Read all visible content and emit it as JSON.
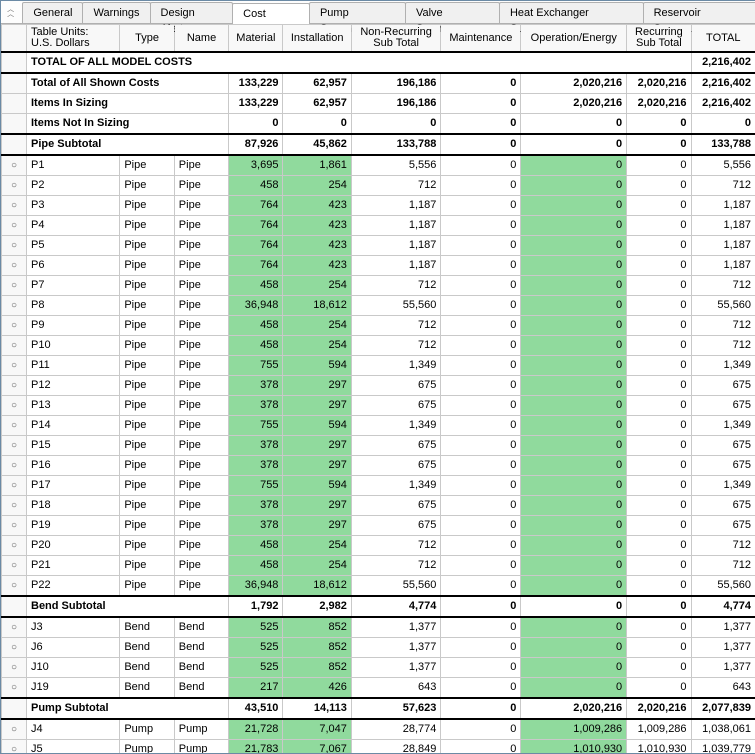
{
  "tabs": [
    {
      "label": "General",
      "active": false
    },
    {
      "label": "Warnings",
      "active": false
    },
    {
      "label": "Design Alerts",
      "active": false
    },
    {
      "label": "Cost Report",
      "active": true
    },
    {
      "label": "Pump Summary",
      "active": false
    },
    {
      "label": "Valve Summary",
      "active": false
    },
    {
      "label": "Heat Exchanger Summary",
      "active": false
    },
    {
      "label": "Reservoir Summary",
      "active": false
    }
  ],
  "headers": {
    "units_l1": "Table Units:",
    "units_l2": "U.S. Dollars",
    "type": "Type",
    "name": "Name",
    "material": "Material",
    "installation": "Installation",
    "nonrec_l1": "Non-Recurring",
    "nonrec_l2": "Sub Total",
    "maintenance": "Maintenance",
    "operation": "Operation/Energy",
    "rec_l1": "Recurring",
    "rec_l2": "Sub Total",
    "total": "TOTAL"
  },
  "rows": [
    {
      "kind": "grand",
      "label": "TOTAL OF ALL MODEL COSTS",
      "total": "2,216,402"
    },
    {
      "kind": "bold",
      "label": "Total of All Shown Costs",
      "mat": "133,229",
      "inst": "62,957",
      "nr": "196,186",
      "mnt": "0",
      "op": "2,020,216",
      "rec": "2,020,216",
      "tot": "2,216,402"
    },
    {
      "kind": "bold",
      "label": "Items In Sizing",
      "mat": "133,229",
      "inst": "62,957",
      "nr": "196,186",
      "mnt": "0",
      "op": "2,020,216",
      "rec": "2,020,216",
      "tot": "2,216,402"
    },
    {
      "kind": "bold",
      "label": "Items Not In Sizing",
      "mat": "0",
      "inst": "0",
      "nr": "0",
      "mnt": "0",
      "op": "0",
      "rec": "0",
      "tot": "0"
    },
    {
      "kind": "sub",
      "label": "Pipe Subtotal",
      "mat": "87,926",
      "inst": "45,862",
      "nr": "133,788",
      "mnt": "0",
      "op": "0",
      "rec": "0",
      "tot": "133,788"
    },
    {
      "kind": "item",
      "label": "P1",
      "type": "Pipe",
      "name": "Pipe",
      "mat": "3,695",
      "inst": "1,861",
      "nr": "5,556",
      "mnt": "0",
      "op": "0",
      "rec": "0",
      "tot": "5,556"
    },
    {
      "kind": "item",
      "label": "P2",
      "type": "Pipe",
      "name": "Pipe",
      "mat": "458",
      "inst": "254",
      "nr": "712",
      "mnt": "0",
      "op": "0",
      "rec": "0",
      "tot": "712"
    },
    {
      "kind": "item",
      "label": "P3",
      "type": "Pipe",
      "name": "Pipe",
      "mat": "764",
      "inst": "423",
      "nr": "1,187",
      "mnt": "0",
      "op": "0",
      "rec": "0",
      "tot": "1,187"
    },
    {
      "kind": "item",
      "label": "P4",
      "type": "Pipe",
      "name": "Pipe",
      "mat": "764",
      "inst": "423",
      "nr": "1,187",
      "mnt": "0",
      "op": "0",
      "rec": "0",
      "tot": "1,187"
    },
    {
      "kind": "item",
      "label": "P5",
      "type": "Pipe",
      "name": "Pipe",
      "mat": "764",
      "inst": "423",
      "nr": "1,187",
      "mnt": "0",
      "op": "0",
      "rec": "0",
      "tot": "1,187"
    },
    {
      "kind": "item",
      "label": "P6",
      "type": "Pipe",
      "name": "Pipe",
      "mat": "764",
      "inst": "423",
      "nr": "1,187",
      "mnt": "0",
      "op": "0",
      "rec": "0",
      "tot": "1,187"
    },
    {
      "kind": "item",
      "label": "P7",
      "type": "Pipe",
      "name": "Pipe",
      "mat": "458",
      "inst": "254",
      "nr": "712",
      "mnt": "0",
      "op": "0",
      "rec": "0",
      "tot": "712"
    },
    {
      "kind": "item",
      "label": "P8",
      "type": "Pipe",
      "name": "Pipe",
      "mat": "36,948",
      "inst": "18,612",
      "nr": "55,560",
      "mnt": "0",
      "op": "0",
      "rec": "0",
      "tot": "55,560"
    },
    {
      "kind": "item",
      "label": "P9",
      "type": "Pipe",
      "name": "Pipe",
      "mat": "458",
      "inst": "254",
      "nr": "712",
      "mnt": "0",
      "op": "0",
      "rec": "0",
      "tot": "712"
    },
    {
      "kind": "item",
      "label": "P10",
      "type": "Pipe",
      "name": "Pipe",
      "mat": "458",
      "inst": "254",
      "nr": "712",
      "mnt": "0",
      "op": "0",
      "rec": "0",
      "tot": "712"
    },
    {
      "kind": "item",
      "label": "P11",
      "type": "Pipe",
      "name": "Pipe",
      "mat": "755",
      "inst": "594",
      "nr": "1,349",
      "mnt": "0",
      "op": "0",
      "rec": "0",
      "tot": "1,349"
    },
    {
      "kind": "item",
      "label": "P12",
      "type": "Pipe",
      "name": "Pipe",
      "mat": "378",
      "inst": "297",
      "nr": "675",
      "mnt": "0",
      "op": "0",
      "rec": "0",
      "tot": "675"
    },
    {
      "kind": "item",
      "label": "P13",
      "type": "Pipe",
      "name": "Pipe",
      "mat": "378",
      "inst": "297",
      "nr": "675",
      "mnt": "0",
      "op": "0",
      "rec": "0",
      "tot": "675"
    },
    {
      "kind": "item",
      "label": "P14",
      "type": "Pipe",
      "name": "Pipe",
      "mat": "755",
      "inst": "594",
      "nr": "1,349",
      "mnt": "0",
      "op": "0",
      "rec": "0",
      "tot": "1,349"
    },
    {
      "kind": "item",
      "label": "P15",
      "type": "Pipe",
      "name": "Pipe",
      "mat": "378",
      "inst": "297",
      "nr": "675",
      "mnt": "0",
      "op": "0",
      "rec": "0",
      "tot": "675"
    },
    {
      "kind": "item",
      "label": "P16",
      "type": "Pipe",
      "name": "Pipe",
      "mat": "378",
      "inst": "297",
      "nr": "675",
      "mnt": "0",
      "op": "0",
      "rec": "0",
      "tot": "675"
    },
    {
      "kind": "item",
      "label": "P17",
      "type": "Pipe",
      "name": "Pipe",
      "mat": "755",
      "inst": "594",
      "nr": "1,349",
      "mnt": "0",
      "op": "0",
      "rec": "0",
      "tot": "1,349"
    },
    {
      "kind": "item",
      "label": "P18",
      "type": "Pipe",
      "name": "Pipe",
      "mat": "378",
      "inst": "297",
      "nr": "675",
      "mnt": "0",
      "op": "0",
      "rec": "0",
      "tot": "675"
    },
    {
      "kind": "item",
      "label": "P19",
      "type": "Pipe",
      "name": "Pipe",
      "mat": "378",
      "inst": "297",
      "nr": "675",
      "mnt": "0",
      "op": "0",
      "rec": "0",
      "tot": "675"
    },
    {
      "kind": "item",
      "label": "P20",
      "type": "Pipe",
      "name": "Pipe",
      "mat": "458",
      "inst": "254",
      "nr": "712",
      "mnt": "0",
      "op": "0",
      "rec": "0",
      "tot": "712"
    },
    {
      "kind": "item",
      "label": "P21",
      "type": "Pipe",
      "name": "Pipe",
      "mat": "458",
      "inst": "254",
      "nr": "712",
      "mnt": "0",
      "op": "0",
      "rec": "0",
      "tot": "712"
    },
    {
      "kind": "item",
      "label": "P22",
      "type": "Pipe",
      "name": "Pipe",
      "mat": "36,948",
      "inst": "18,612",
      "nr": "55,560",
      "mnt": "0",
      "op": "0",
      "rec": "0",
      "tot": "55,560"
    },
    {
      "kind": "sub",
      "label": "Bend Subtotal",
      "mat": "1,792",
      "inst": "2,982",
      "nr": "4,774",
      "mnt": "0",
      "op": "0",
      "rec": "0",
      "tot": "4,774"
    },
    {
      "kind": "item",
      "label": "J3",
      "type": "Bend",
      "name": "Bend",
      "mat": "525",
      "inst": "852",
      "nr": "1,377",
      "mnt": "0",
      "op": "0",
      "rec": "0",
      "tot": "1,377"
    },
    {
      "kind": "item",
      "label": "J6",
      "type": "Bend",
      "name": "Bend",
      "mat": "525",
      "inst": "852",
      "nr": "1,377",
      "mnt": "0",
      "op": "0",
      "rec": "0",
      "tot": "1,377"
    },
    {
      "kind": "item",
      "label": "J10",
      "type": "Bend",
      "name": "Bend",
      "mat": "525",
      "inst": "852",
      "nr": "1,377",
      "mnt": "0",
      "op": "0",
      "rec": "0",
      "tot": "1,377"
    },
    {
      "kind": "item",
      "label": "J19",
      "type": "Bend",
      "name": "Bend",
      "mat": "217",
      "inst": "426",
      "nr": "643",
      "mnt": "0",
      "op": "0",
      "rec": "0",
      "tot": "643"
    },
    {
      "kind": "sub",
      "label": "Pump Subtotal",
      "mat": "43,510",
      "inst": "14,113",
      "nr": "57,623",
      "mnt": "0",
      "op": "2,020,216",
      "rec": "2,020,216",
      "tot": "2,077,839"
    },
    {
      "kind": "item",
      "label": "J4",
      "type": "Pump",
      "name": "Pump",
      "mat": "21,728",
      "inst": "7,047",
      "nr": "28,774",
      "mnt": "0",
      "op": "1,009,286",
      "opg": true,
      "rec": "1,009,286",
      "tot": "1,038,061"
    },
    {
      "kind": "item",
      "label": "J5",
      "type": "Pump",
      "name": "Pump",
      "mat": "21,783",
      "inst": "7,067",
      "nr": "28,849",
      "mnt": "0",
      "op": "1,010,930",
      "opg": true,
      "rec": "1,010,930",
      "tot": "1,039,779"
    }
  ]
}
